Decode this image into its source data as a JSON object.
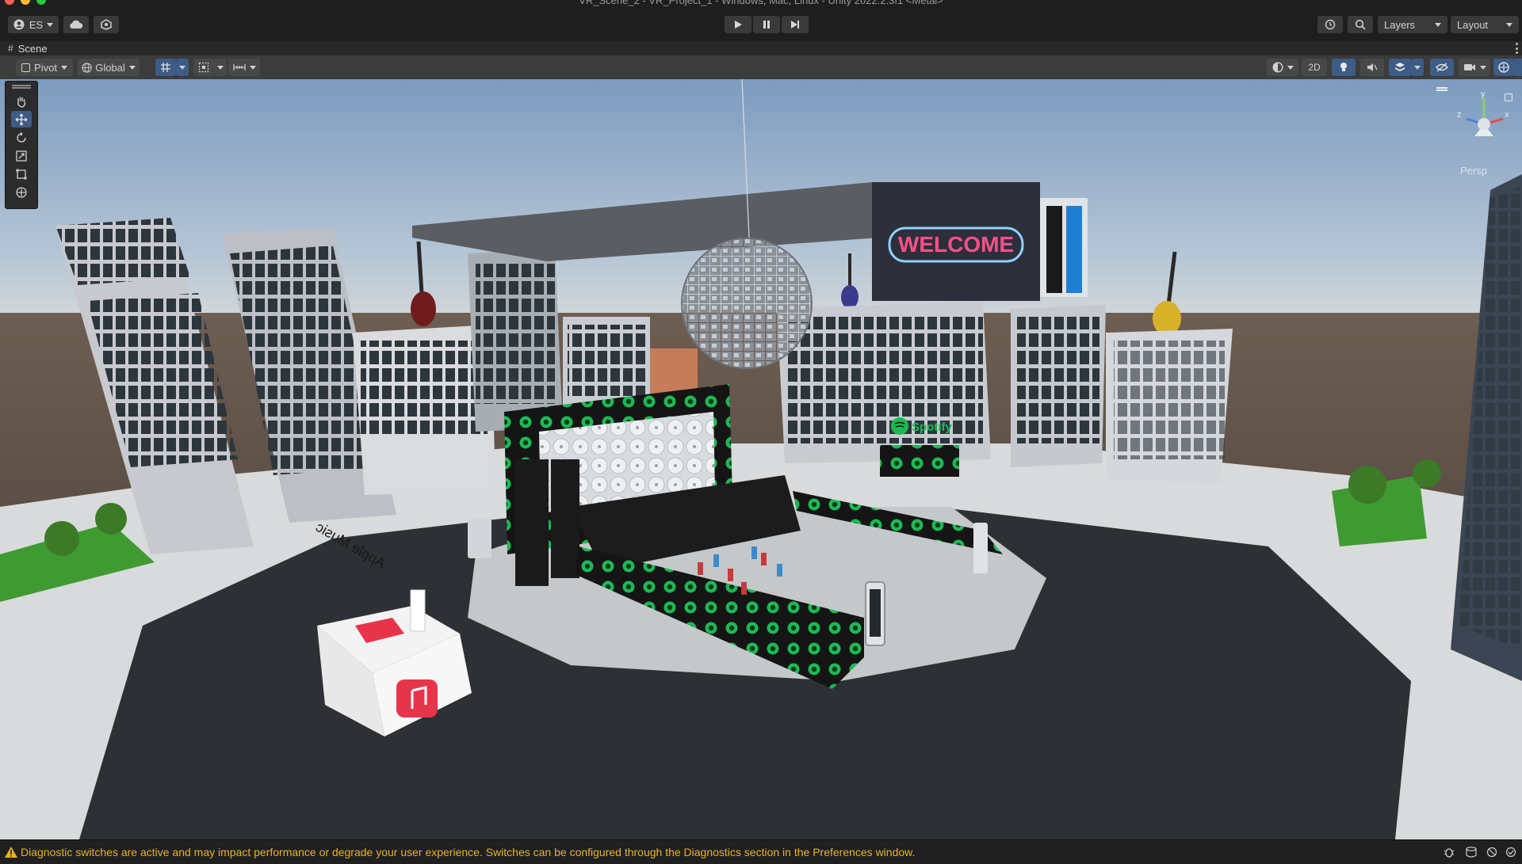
{
  "window": {
    "title": "VR_Scene_2 - VR_Project_1 - Windows, Mac, Linux - Unity 2022.2.3f1 <Metal>"
  },
  "toolbar": {
    "account_label": "ES",
    "layers_label": "Layers",
    "layout_label": "Layout",
    "play_icon": "play-icon",
    "pause_icon": "pause-icon",
    "step_icon": "step-icon"
  },
  "scene_tab": {
    "label": "Scene"
  },
  "scene_toolbar": {
    "pivot_label": "Pivot",
    "global_label": "Global",
    "mode_2d_label": "2D"
  },
  "scene": {
    "welcome_sign": "WELCOME",
    "spotify_label": "Spotify",
    "apple_music_label": "Apple Music",
    "gizmo_axes": {
      "y": "y",
      "x": "x",
      "z": "z"
    },
    "gizmo_projection": "Persp"
  },
  "tools": [
    "hand-tool-icon",
    "move-tool-icon",
    "rotate-tool-icon",
    "scale-tool-icon",
    "rect-tool-icon",
    "transform-tool-icon"
  ],
  "status": {
    "message": "Diagnostic switches are active and may impact performance or degrade your user experience. Switches can be configured through the Diagnostics section in the Preferences window."
  },
  "colors": {
    "accent": "#3d5c86",
    "warning": "#e6b422",
    "spotify_green": "#1db954",
    "neon_pink": "#ff4f8b",
    "apple_red": "#e8344a"
  }
}
